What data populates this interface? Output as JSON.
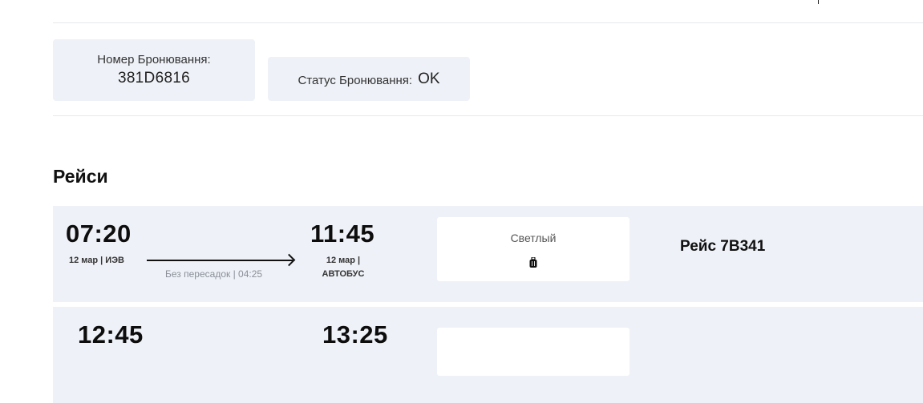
{
  "booking": {
    "number_label": "Номер Бронювання:",
    "number_value": "381D6816",
    "status_label": "Статус Бронювання:",
    "status_value": "OK"
  },
  "section": {
    "title": "Рейси"
  },
  "flights": [
    {
      "departure_time": "07:20",
      "departure_info": "12 мар | ИЭВ",
      "arrival_time": "11:45",
      "arrival_info_line1": "12 мар |",
      "arrival_info_line2": "АВТОБУС",
      "transfer_info": "Без пересадок | 04:25",
      "bus_name": "Светлый",
      "luggage_icon": "luggage-icon",
      "flight_label": "Рейс 7B341"
    },
    {
      "departure_time": "12:45",
      "arrival_time": "13:25"
    }
  ],
  "colors": {
    "card_bg": "#eef1f7",
    "divider": "#e6e8ec",
    "text_dark": "#111111",
    "text_muted": "#8a8f98"
  }
}
